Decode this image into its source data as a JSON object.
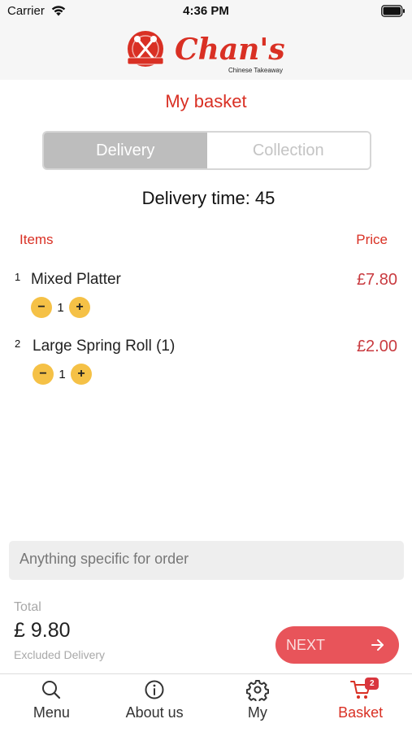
{
  "status_bar": {
    "carrier": "Carrier",
    "time": "4:36 PM"
  },
  "header": {
    "brand": "Chan's",
    "brand_tagline": "Chinese Takeaway",
    "brand_color": "#d93024"
  },
  "page": {
    "title": "My basket"
  },
  "mode_toggle": {
    "options": [
      "Delivery",
      "Collection"
    ],
    "selected": "Delivery"
  },
  "delivery_time": {
    "label": "Delivery time:",
    "value": "45"
  },
  "table": {
    "items_header": "Items",
    "price_header": "Price"
  },
  "basket_items": [
    {
      "index": "1",
      "name": "Mixed Platter",
      "quantity": "1",
      "price": "£7.80",
      "decrement_icon": "minus-icon",
      "increment_icon": "plus-icon"
    },
    {
      "index": "2",
      "name": "Large Spring Roll (1)",
      "quantity": "1",
      "price": "£2.00",
      "decrement_icon": "minus-icon",
      "increment_icon": "plus-icon"
    }
  ],
  "order_note": {
    "placeholder": "Anything specific for order"
  },
  "summary": {
    "total_label": "Total",
    "total_value": "£ 9.80",
    "note": "Excluded Delivery"
  },
  "next_button": {
    "label": "NEXT",
    "icon": "arrow-right-icon",
    "color": "#e8545a"
  },
  "tab_bar": {
    "tabs": [
      {
        "label": "Menu",
        "icon": "search-icon"
      },
      {
        "label": "About us",
        "icon": "info-icon"
      },
      {
        "label": "My",
        "icon": "gear-icon"
      },
      {
        "label": "Basket",
        "icon": "cart-icon",
        "badge": "2",
        "active": true
      }
    ],
    "active_color": "#d93024"
  }
}
